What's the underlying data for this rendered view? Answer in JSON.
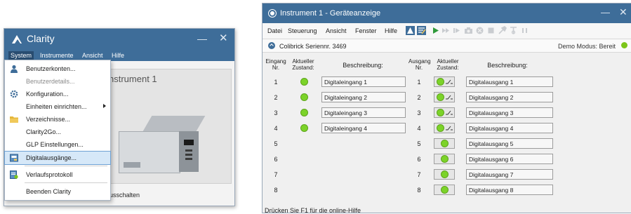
{
  "left_window": {
    "title": "Clarity",
    "menus": [
      "System",
      "Instrumente",
      "Ansicht",
      "Hilfe"
    ],
    "instrument_label": "nstrument 1",
    "status_text": "usschalten",
    "dropdown": [
      {
        "label": "Benutzerkonten...",
        "icon": "user-icon",
        "disabled": false
      },
      {
        "label": "Benutzerdetails...",
        "icon": "",
        "disabled": true
      },
      {
        "label": "Konfiguration...",
        "icon": "gear-icon",
        "disabled": false
      },
      {
        "label": "Einheiten einrichten...",
        "icon": "",
        "disabled": false,
        "submenu": true
      },
      {
        "label": "Verzeichnisse...",
        "icon": "folder-icon",
        "disabled": false
      },
      {
        "label": "Clarity2Go...",
        "icon": "",
        "disabled": false
      },
      {
        "label": "GLP Einstellungen...",
        "icon": "",
        "disabled": false
      },
      {
        "label": "Digitalausgänge...",
        "icon": "digital-outputs-icon",
        "disabled": false,
        "highlighted": true
      },
      {
        "label": "Verlaufsprotokoll",
        "icon": "audit-trail-icon",
        "disabled": false
      },
      {
        "label": "Beenden Clarity",
        "icon": "",
        "disabled": false
      }
    ]
  },
  "right_window": {
    "title": "Instrument 1 - Geräteanzeige",
    "menus": [
      "Datei",
      "Steuerung",
      "Ansicht",
      "Fenster",
      "Hilfe"
    ],
    "serial": "Colibrick Seriennr. 3469",
    "demo_status": "Demo Modus: Bereit",
    "headers": {
      "in_nr": "Eingang\nNr.",
      "in_state": "Aktueller\nZustand:",
      "in_desc": "Beschreibung:",
      "out_nr": "Ausgang\nNr.",
      "out_state": "Aktueller\nZustand:",
      "out_desc": "Beschreibung:"
    },
    "inputs": [
      {
        "nr": "1",
        "desc": "Digitaleingang 1"
      },
      {
        "nr": "2",
        "desc": "Digitaleingang 2"
      },
      {
        "nr": "3",
        "desc": "Digitaleingang 3"
      },
      {
        "nr": "4",
        "desc": "Digitaleingang 4"
      },
      {
        "nr": "5",
        "desc": ""
      },
      {
        "nr": "6",
        "desc": ""
      },
      {
        "nr": "7",
        "desc": ""
      },
      {
        "nr": "8",
        "desc": ""
      }
    ],
    "outputs": [
      {
        "nr": "1",
        "desc": "Digitalausgang 1",
        "switch": true
      },
      {
        "nr": "2",
        "desc": "Digitalausgang 2",
        "switch": true
      },
      {
        "nr": "3",
        "desc": "Digitalausgang 3",
        "switch": true
      },
      {
        "nr": "4",
        "desc": "Digitalausgang 4",
        "switch": true
      },
      {
        "nr": "5",
        "desc": "Digitalausgang 5",
        "switch": false
      },
      {
        "nr": "6",
        "desc": "Digitalausgang 6",
        "switch": false
      },
      {
        "nr": "7",
        "desc": "Digitalausgang 7",
        "switch": false
      },
      {
        "nr": "8",
        "desc": "Digitalausgang 8",
        "switch": false
      }
    ],
    "help_text": "Drücken Sie F1 für die online-Hilfe",
    "colors": {
      "accent": "#3e6d99",
      "led_on": "#7cd329",
      "ok": "#7cc51a"
    }
  }
}
